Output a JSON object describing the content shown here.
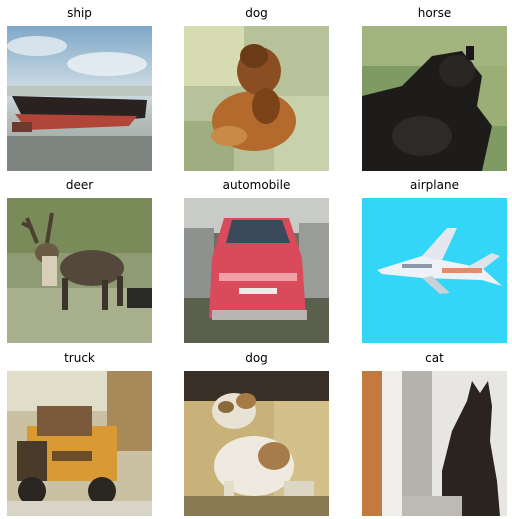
{
  "grid": {
    "tiles": [
      {
        "label": "ship"
      },
      {
        "label": "dog"
      },
      {
        "label": "horse"
      },
      {
        "label": "deer"
      },
      {
        "label": "automobile"
      },
      {
        "label": "airplane"
      },
      {
        "label": "truck"
      },
      {
        "label": "dog"
      },
      {
        "label": "cat"
      }
    ]
  }
}
